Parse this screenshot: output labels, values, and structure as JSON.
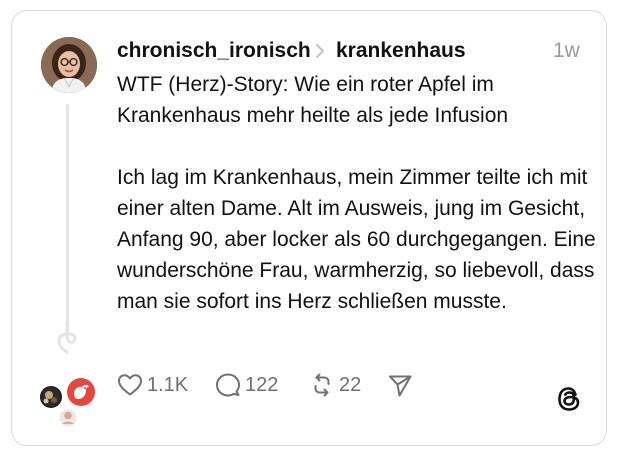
{
  "post": {
    "username": "chronisch_ironisch",
    "topic": "krankenhaus",
    "timestamp": "1w",
    "paragraphs": [
      "WTF (Herz)-Story: Wie ein roter Apfel im Krankenhaus mehr heilte als jede Infusion",
      "Ich lag im Krankenhaus, mein Zimmer teilte ich mit einer alten Dame. Alt im Ausweis, jung im Gesicht, Anfang 90, aber locker als 60 durchgegangen. Eine wunderschöne Frau, warmherzig, so liebevoll, dass man sie sofort ins Herz schließen musste."
    ]
  },
  "actions": {
    "likes": "1.1K",
    "replies": "122",
    "reposts": "22"
  },
  "icons": {
    "like": "heart-icon",
    "reply": "speech-bubble-icon",
    "repost": "repost-arrows-icon",
    "share": "paper-plane-icon",
    "brand": "threads-logo-icon",
    "topic_separator": "chevron-right-icon"
  },
  "colors": {
    "text": "#111111",
    "muted": "#9a9a9a",
    "action_gray": "#707070",
    "border": "#d9d9d9",
    "thread_line": "#e4e4e4",
    "repost_badge": "#e8453c"
  }
}
